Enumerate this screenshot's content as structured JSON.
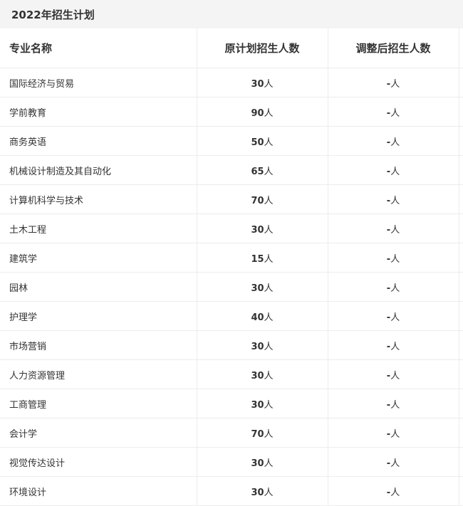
{
  "page": {
    "title": "2022年招生计划"
  },
  "table": {
    "headers": {
      "major": "专业名称",
      "original": "原计划招生人数",
      "adjusted": "调整后招生人数"
    },
    "rows": [
      {
        "major": "国际经济与贸易",
        "original_num": "30",
        "original_unit": "人",
        "adjusted_num": "-",
        "adjusted_unit": "人"
      },
      {
        "major": "学前教育",
        "original_num": "90",
        "original_unit": "人",
        "adjusted_num": "-",
        "adjusted_unit": "人"
      },
      {
        "major": "商务英语",
        "original_num": "50",
        "original_unit": "人",
        "adjusted_num": "-",
        "adjusted_unit": "人"
      },
      {
        "major": "机械设计制造及其自动化",
        "original_num": "65",
        "original_unit": "人",
        "adjusted_num": "-",
        "adjusted_unit": "人"
      },
      {
        "major": "计算机科学与技术",
        "original_num": "70",
        "original_unit": "人",
        "adjusted_num": "-",
        "adjusted_unit": "人"
      },
      {
        "major": "土木工程",
        "original_num": "30",
        "original_unit": "人",
        "adjusted_num": "-",
        "adjusted_unit": "人"
      },
      {
        "major": "建筑学",
        "original_num": "15",
        "original_unit": "人",
        "adjusted_num": "-",
        "adjusted_unit": "人"
      },
      {
        "major": "园林",
        "original_num": "30",
        "original_unit": "人",
        "adjusted_num": "-",
        "adjusted_unit": "人"
      },
      {
        "major": "护理学",
        "original_num": "40",
        "original_unit": "人",
        "adjusted_num": "-",
        "adjusted_unit": "人"
      },
      {
        "major": "市场营销",
        "original_num": "30",
        "original_unit": "人",
        "adjusted_num": "-",
        "adjusted_unit": "人"
      },
      {
        "major": "人力资源管理",
        "original_num": "30",
        "original_unit": "人",
        "adjusted_num": "-",
        "adjusted_unit": "人"
      },
      {
        "major": "工商管理",
        "original_num": "30",
        "original_unit": "人",
        "adjusted_num": "-",
        "adjusted_unit": "人"
      },
      {
        "major": "会计学",
        "original_num": "70",
        "original_unit": "人",
        "adjusted_num": "-",
        "adjusted_unit": "人"
      },
      {
        "major": "视觉传达设计",
        "original_num": "30",
        "original_unit": "人",
        "adjusted_num": "-",
        "adjusted_unit": "人"
      },
      {
        "major": "环境设计",
        "original_num": "30",
        "original_unit": "人",
        "adjusted_num": "-",
        "adjusted_unit": "人"
      }
    ]
  }
}
